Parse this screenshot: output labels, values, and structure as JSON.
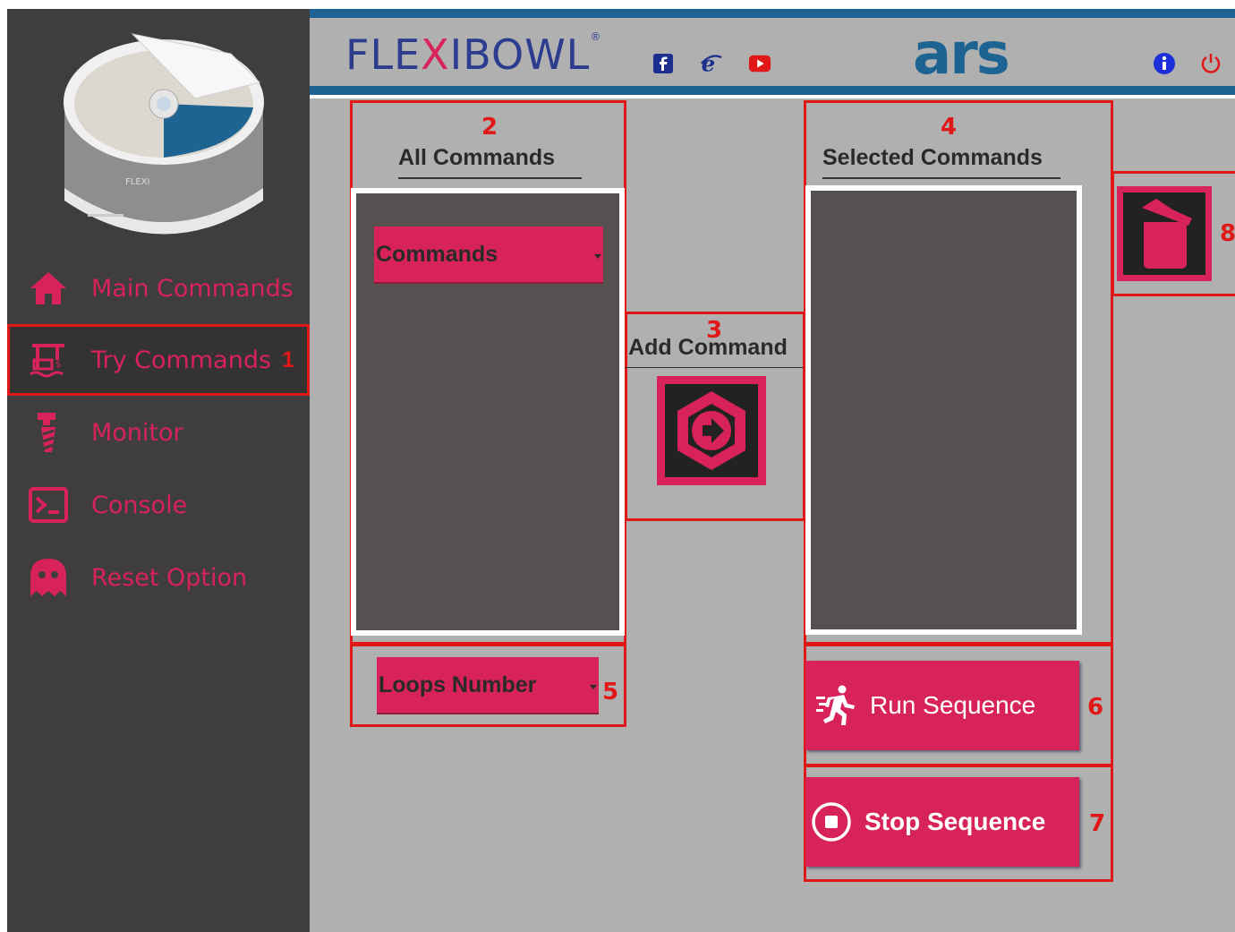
{
  "sidebar": {
    "items": [
      {
        "label": "Main Commands",
        "icon": "home-icon",
        "active": false
      },
      {
        "label": "Try Commands",
        "icon": "try-commands-icon",
        "active": true,
        "marker": "1"
      },
      {
        "label": "Monitor",
        "icon": "monitor-icon",
        "active": false
      },
      {
        "label": "Console",
        "icon": "console-icon",
        "active": false
      },
      {
        "label": "Reset Option",
        "icon": "ghost-icon",
        "active": false
      }
    ]
  },
  "header": {
    "logo_text_a": "FLE",
    "logo_text_x": "X",
    "logo_text_b": "IBOWL",
    "logo_reg": "®",
    "brand": "ars",
    "social_icons": [
      "facebook-icon",
      "internet-explorer-icon",
      "youtube-icon"
    ],
    "right_icons": [
      "info-icon",
      "power-icon"
    ]
  },
  "all_commands": {
    "marker": "2",
    "title": "All Commands",
    "dropdown_value": "Commands"
  },
  "add_command": {
    "marker": "3",
    "label": "Add Command"
  },
  "selected_commands": {
    "marker": "4",
    "title": "Selected Commands"
  },
  "loops": {
    "marker": "5",
    "dropdown_value": "Loops Number"
  },
  "run": {
    "marker": "6",
    "label": "Run Sequence"
  },
  "stop": {
    "marker": "7",
    "label": "Stop Sequence"
  },
  "trash": {
    "marker": "8"
  },
  "colors": {
    "accent": "#d8225a",
    "sidebar_bg": "#3f3d3e",
    "main_bg": "#b0b0b0",
    "header_blue": "#1d6493",
    "annotation_red": "#e01818",
    "panel_bg": "#565050"
  }
}
